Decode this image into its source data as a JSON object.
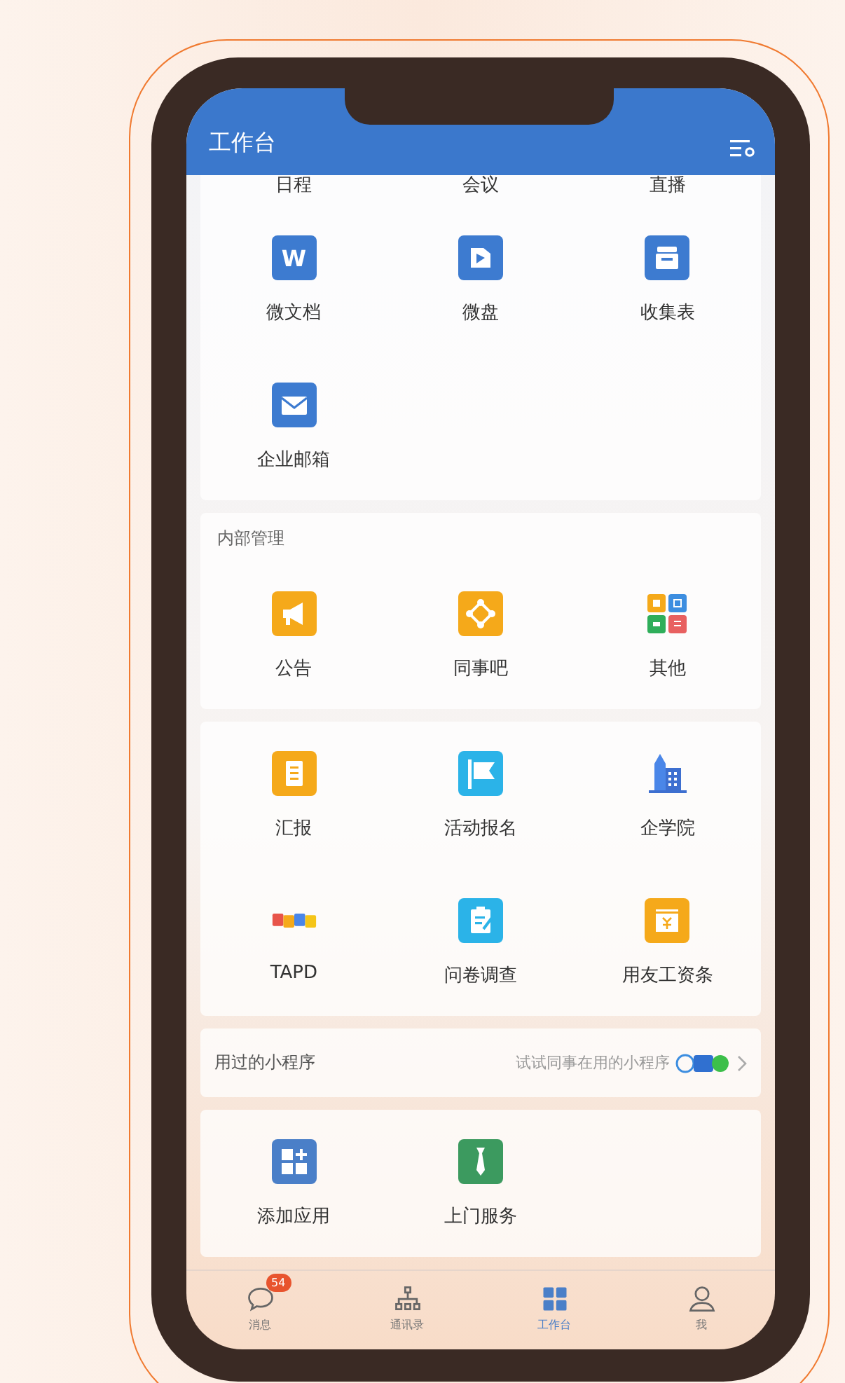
{
  "header": {
    "title": "工作台"
  },
  "sections": [
    {
      "rows": [
        [
          {
            "label": "日程",
            "kind": "none"
          },
          {
            "label": "会议",
            "kind": "none"
          },
          {
            "label": "直播",
            "kind": "none"
          }
        ],
        [
          {
            "label": "微文档",
            "kind": "word",
            "mark": "W"
          },
          {
            "label": "微盘",
            "kind": "disk"
          },
          {
            "label": "收集表",
            "kind": "form"
          }
        ],
        [
          {
            "label": "企业邮箱",
            "kind": "mail"
          }
        ]
      ]
    },
    {
      "title": "内部管理",
      "rows": [
        [
          {
            "label": "公告",
            "kind": "megaphone"
          },
          {
            "label": "同事吧",
            "kind": "nodes"
          },
          {
            "label": "其他",
            "kind": "grid4"
          }
        ]
      ]
    },
    {
      "rows": [
        [
          {
            "label": "汇报",
            "kind": "report"
          },
          {
            "label": "活动报名",
            "kind": "flag"
          },
          {
            "label": "企学院",
            "kind": "building"
          }
        ],
        [
          {
            "label": "TAPD",
            "kind": "tapd"
          },
          {
            "label": "问卷调查",
            "kind": "survey"
          },
          {
            "label": "用友工资条",
            "kind": "salary"
          }
        ]
      ]
    }
  ],
  "mini_programs": {
    "title": "用过的小程序",
    "hint": "试试同事在用的小程序"
  },
  "extra": [
    {
      "label": "添加应用",
      "kind": "add"
    },
    {
      "label": "上门服务",
      "kind": "tie"
    }
  ],
  "tabs": [
    {
      "label": "消息",
      "kind": "chat",
      "badge": "54",
      "selected": false
    },
    {
      "label": "通讯录",
      "kind": "org",
      "selected": false
    },
    {
      "label": "工作台",
      "kind": "grid",
      "selected": true
    },
    {
      "label": "我",
      "kind": "person",
      "selected": false
    }
  ]
}
